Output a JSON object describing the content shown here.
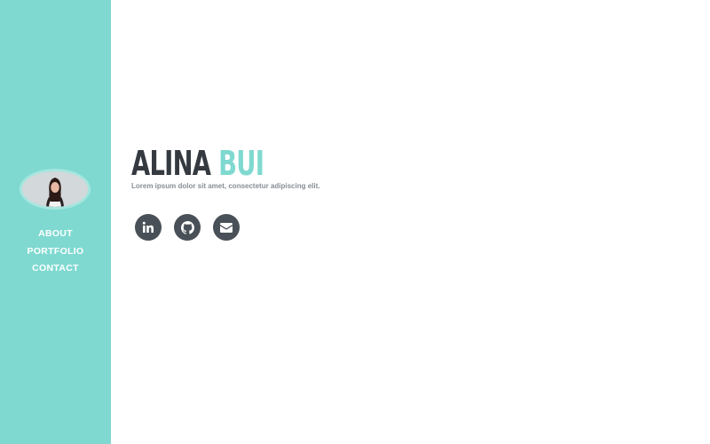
{
  "sidebar": {
    "nav": [
      {
        "label": "ABOUT"
      },
      {
        "label": "PORTFOLIO"
      },
      {
        "label": "CONTACT"
      }
    ]
  },
  "hero": {
    "first_name": "ALINA",
    "last_name": "BUI",
    "subtitle": "Lorem ipsum dolor sit amet, consectetur adipiscing elit."
  },
  "socials": [
    {
      "icon": "linkedin-icon"
    },
    {
      "icon": "github-icon"
    },
    {
      "icon": "envelope-icon"
    }
  ],
  "colors": {
    "accent": "#7fd9d0",
    "dark": "#343a40",
    "icon_bg": "#495057",
    "muted_text": "#868e96"
  }
}
